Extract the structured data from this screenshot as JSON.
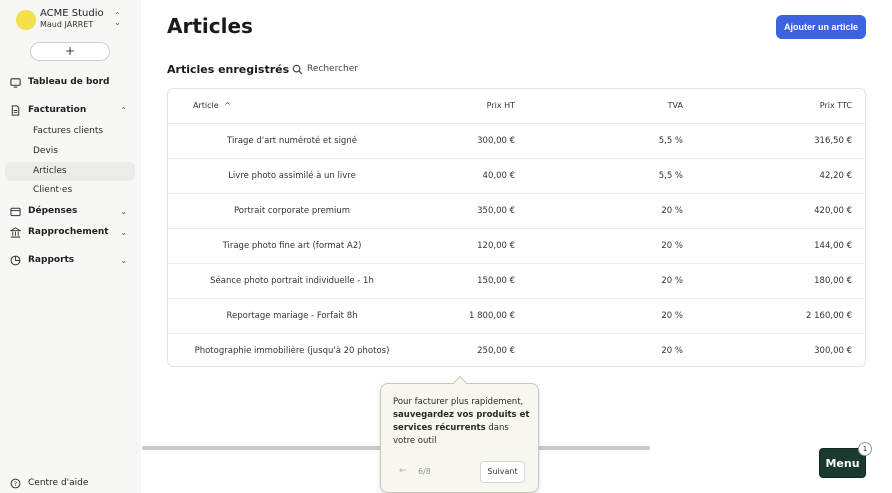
{
  "sidebar": {
    "org_name": "ACME Studio",
    "user_name": "Maud JARRET",
    "new_button": "+",
    "dashboard": "Tableau de bord",
    "billing": "Facturation",
    "billing_sub": [
      "Factures clients",
      "Devis",
      "Articles",
      "Client·es"
    ],
    "expenses": "Dépenses",
    "reconciliation": "Rapprochement",
    "reports": "Rapports",
    "help": "Centre d'aide"
  },
  "header": {
    "title": "Articles",
    "add_button": "Ajouter un article"
  },
  "section": {
    "title": "Articles enregistrés",
    "search_label": "Rechercher"
  },
  "table": {
    "columns": [
      "Article",
      "Prix HT",
      "TVA",
      "Prix TTC"
    ],
    "sort_indicator": "^",
    "rows": [
      {
        "name": "Tirage d'art numéroté et signé",
        "ht": "300,00 €",
        "tva": "5,5 %",
        "ttc": "316,50 €"
      },
      {
        "name": "Livre photo assimilé à un livre",
        "ht": "40,00 €",
        "tva": "5,5 %",
        "ttc": "42,20 €"
      },
      {
        "name": "Portrait corporate premium",
        "ht": "350,00 €",
        "tva": "20 %",
        "ttc": "420,00 €"
      },
      {
        "name": "Tirage photo fine art (format A2)",
        "ht": "120,00 €",
        "tva": "20 %",
        "ttc": "144,00 €"
      },
      {
        "name": "Séance photo portrait individuelle - 1h",
        "ht": "150,00 €",
        "tva": "20 %",
        "ttc": "180,00 €"
      },
      {
        "name": "Reportage mariage - Forfait 8h",
        "ht": "1 800,00 €",
        "tva": "20 %",
        "ttc": "2 160,00 €"
      },
      {
        "name": "Photographie immobilière (jusqu'à 20 photos)",
        "ht": "250,00 €",
        "tva": "20 %",
        "ttc": "300,00 €"
      }
    ]
  },
  "tooltip": {
    "text_start": "Pour facturer plus rapidement, ",
    "text_bold": "sauvegardez vos produits et services récurrents",
    "text_end": " dans votre outil",
    "prev": "←",
    "step": "6/8",
    "next": "Suivant"
  },
  "menu": {
    "label": "Menu",
    "badge": "1"
  },
  "colors": {
    "accent": "#3b63e0",
    "menu_bg": "#1a3a2b",
    "logo": "#f4e04d"
  }
}
